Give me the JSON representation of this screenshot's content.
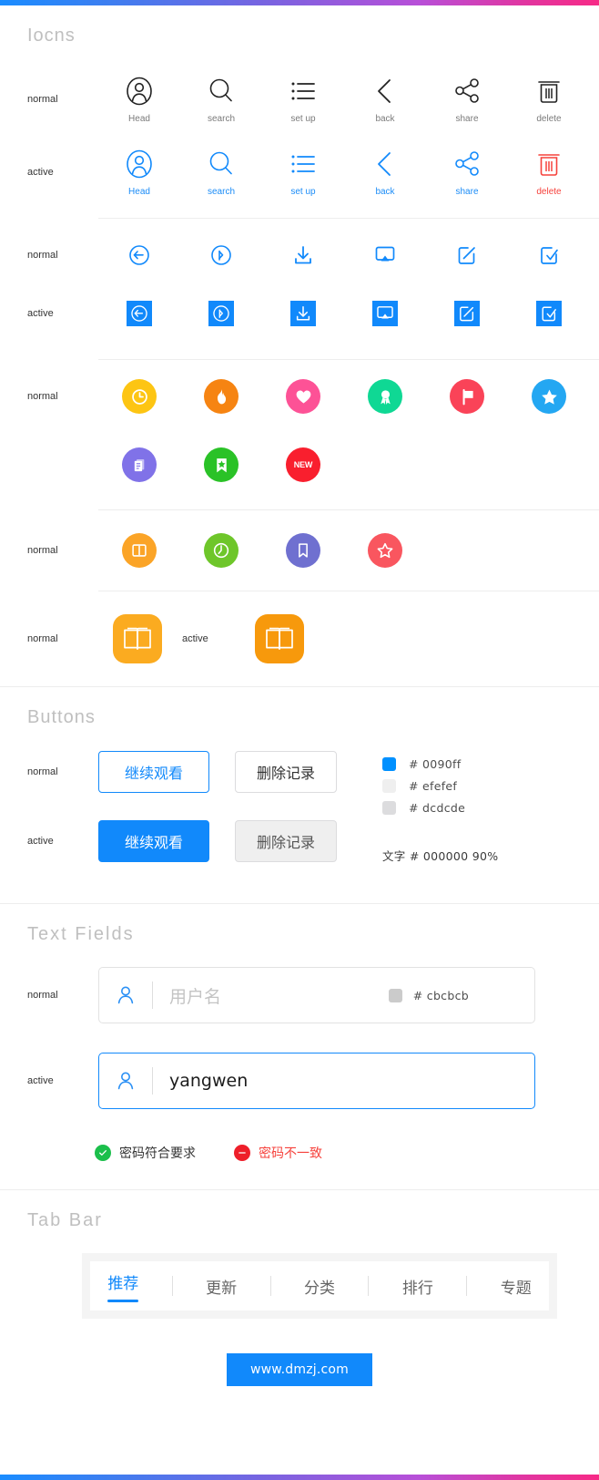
{
  "theme": {
    "accent": "#0090ff",
    "accent_ui": "#1189fb",
    "danger": "#f6423c",
    "success": "#1bbf4b",
    "muted_text": "#bfbfbf",
    "gradient_start": "#1a8cff",
    "gradient_end": "#f72a86"
  },
  "sections": {
    "icons": {
      "title": "Iocns",
      "row1": {
        "state": "normal",
        "items": [
          {
            "icon": "head-icon",
            "label": "Head"
          },
          {
            "icon": "search-icon",
            "label": "search"
          },
          {
            "icon": "set-up-icon",
            "label": "set up"
          },
          {
            "icon": "back-icon",
            "label": "back"
          },
          {
            "icon": "share-icon",
            "label": "share"
          },
          {
            "icon": "delete-icon",
            "label": "delete"
          }
        ]
      },
      "row2": {
        "state": "active",
        "items": [
          {
            "icon": "head-icon",
            "label": "Head"
          },
          {
            "icon": "search-icon",
            "label": "search"
          },
          {
            "icon": "set-up-icon",
            "label": "set up"
          },
          {
            "icon": "back-icon",
            "label": "back"
          },
          {
            "icon": "share-icon",
            "label": "share"
          },
          {
            "icon": "delete-icon",
            "label": "delete"
          }
        ]
      },
      "row3": {
        "state": "normal",
        "items": [
          {
            "icon": "history-back-icon"
          },
          {
            "icon": "history-forward-icon"
          },
          {
            "icon": "download-icon"
          },
          {
            "icon": "airplay-icon"
          },
          {
            "icon": "edit-icon"
          },
          {
            "icon": "check-doc-icon"
          }
        ]
      },
      "row4": {
        "state": "active",
        "items": [
          {
            "icon": "history-back-icon"
          },
          {
            "icon": "history-forward-icon"
          },
          {
            "icon": "download-icon"
          },
          {
            "icon": "airplay-icon"
          },
          {
            "icon": "edit-icon"
          },
          {
            "icon": "check-doc-icon"
          }
        ]
      },
      "row5": {
        "state": "normal",
        "items": [
          {
            "icon": "clock-icon",
            "color": "#fdc513"
          },
          {
            "icon": "flame-icon",
            "color": "#f68412"
          },
          {
            "icon": "heart-icon",
            "color": "#fd5296"
          },
          {
            "icon": "medal-icon",
            "color": "#0fd894"
          },
          {
            "icon": "flag-icon",
            "color": "#fa4358"
          },
          {
            "icon": "star-icon",
            "color": "#24a7f2"
          }
        ]
      },
      "row6": {
        "items": [
          {
            "icon": "document-icon",
            "color": "#8072e8"
          },
          {
            "icon": "bookmark-star-icon",
            "color": "#2ac227"
          },
          {
            "icon": "new-badge-icon",
            "color": "#f91f2e",
            "text": "NEW"
          }
        ]
      },
      "row7": {
        "state": "normal",
        "items": [
          {
            "icon": "book-open-outline-icon",
            "color": "#fba427"
          },
          {
            "icon": "clock-outline-icon",
            "color": "#6ec62a"
          },
          {
            "icon": "bookmark-outline-icon",
            "color": "#6f70d0"
          },
          {
            "icon": "star-outline-icon",
            "color": "#f9565f"
          }
        ]
      },
      "row8": {
        "state_normal": "normal",
        "state_active": "active",
        "icon": "open-book-app-icon",
        "color": "#fbab20"
      }
    },
    "buttons": {
      "title": "Buttons",
      "state_normal": "normal",
      "state_active": "active",
      "primary_label": "继续观看",
      "secondary_label": "删除记录",
      "swatches": [
        {
          "color": "#0090ff",
          "label": "# 0090ff"
        },
        {
          "color": "#efefef",
          "label": "# efefef"
        },
        {
          "color": "#dcdcde",
          "label": "# dcdcde"
        }
      ],
      "text_note": "文字  # 000000  90%"
    },
    "text_fields": {
      "title": "Text  Fields",
      "state_normal": "normal",
      "state_active": "active",
      "placeholder": "用户名",
      "value": "yangwen",
      "swatch_color": "#cbcbcb",
      "swatch_label": "# cbcbcb",
      "validation": [
        {
          "status": "success",
          "icon": "check-circle-icon",
          "text": "密码符合要求"
        },
        {
          "status": "error",
          "icon": "minus-circle-icon",
          "text": "密码不一致"
        }
      ]
    },
    "tab_bar": {
      "title": "Tab  Bar",
      "tabs": [
        {
          "label": "推荐",
          "active": true
        },
        {
          "label": "更新",
          "active": false
        },
        {
          "label": "分类",
          "active": false
        },
        {
          "label": "排行",
          "active": false
        },
        {
          "label": "专题",
          "active": false
        }
      ]
    },
    "footer": {
      "button_label": "www.dmzj.com"
    }
  }
}
